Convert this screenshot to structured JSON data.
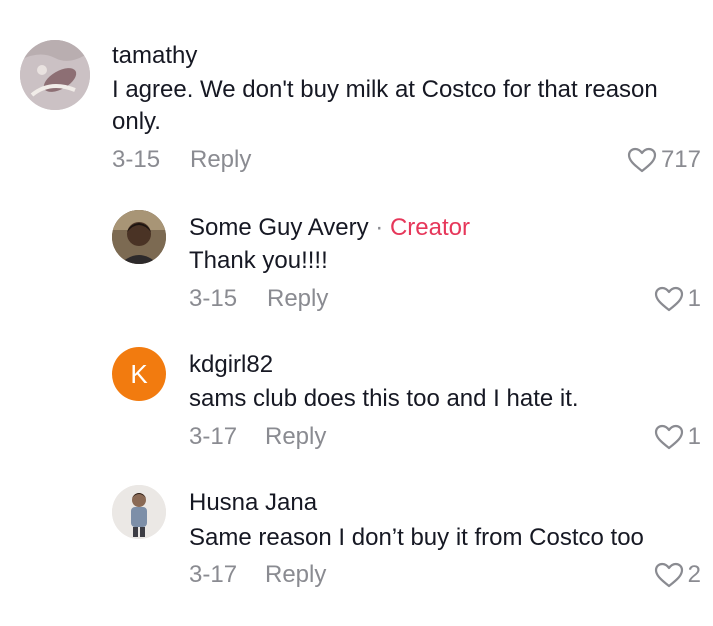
{
  "comments": [
    {
      "username": "tamathy",
      "text": "I agree. We don't buy milk at Costco for that reason only.",
      "date": "3-15",
      "reply_label": "Reply",
      "likes": "717",
      "avatar_icon": "abstract-photo-avatar"
    },
    {
      "username": "Some Guy Avery",
      "creator_separator": " · ",
      "creator_label": "Creator",
      "text": "Thank you!!!!",
      "date": "3-15",
      "reply_label": "Reply",
      "likes": "1",
      "avatar_icon": "person-photo-avatar"
    },
    {
      "username": "kdgirl82",
      "text": "sams club does this too and I hate it.",
      "date": "3-17",
      "reply_label": "Reply",
      "likes": "1",
      "avatar_letter": "K",
      "avatar_color": "#f27b0f"
    },
    {
      "username": "Husna Jana",
      "text": "Same reason I don’t buy it from Costco too",
      "date": "3-17",
      "reply_label": "Reply",
      "likes": "2",
      "avatar_icon": "child-photo-avatar"
    }
  ],
  "colors": {
    "text_primary": "#161823",
    "text_secondary": "#8a8b91",
    "creator_accent": "#e6375a"
  }
}
